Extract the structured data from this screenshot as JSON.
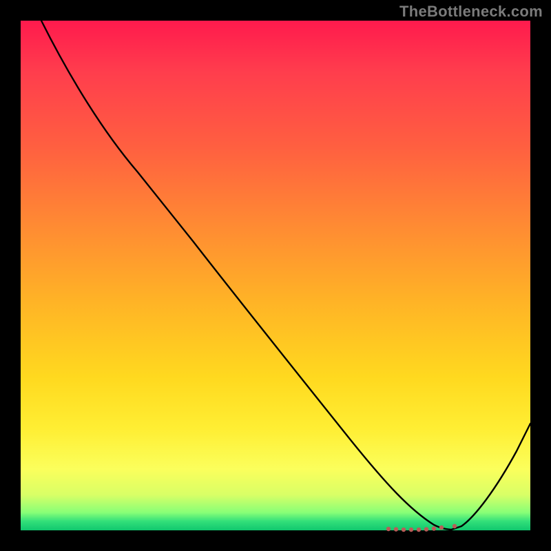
{
  "watermark": "TheBottleneck.com",
  "chart_data": {
    "type": "line",
    "title": "",
    "xlabel": "",
    "ylabel": "",
    "xlim": [
      0,
      100
    ],
    "ylim": [
      0,
      100
    ],
    "series": [
      {
        "name": "bottleneck-curve",
        "x": [
          4,
          10,
          18,
          24,
          30,
          38,
          46,
          54,
          62,
          70,
          76,
          80,
          83,
          85,
          90,
          95,
          100
        ],
        "y": [
          100,
          90,
          78,
          70,
          64,
          55,
          46,
          37,
          28,
          18,
          10,
          4,
          1,
          0,
          6,
          16,
          30
        ]
      }
    ],
    "markers": {
      "name": "optimal-zone-dots",
      "x": [
        72,
        73.5,
        75,
        76.5,
        78,
        79.5,
        81,
        82.5,
        85
      ],
      "y": [
        0.2,
        0.1,
        0.0,
        0.0,
        0.0,
        0.1,
        0.3,
        0.5,
        0.8
      ]
    },
    "gradient_stops": [
      {
        "pct": 0,
        "color": "#ff1a4d"
      },
      {
        "pct": 25,
        "color": "#ff6040"
      },
      {
        "pct": 55,
        "color": "#ffb326"
      },
      {
        "pct": 80,
        "color": "#ffee33"
      },
      {
        "pct": 96,
        "color": "#88ff77"
      },
      {
        "pct": 100,
        "color": "#10c76e"
      }
    ]
  }
}
